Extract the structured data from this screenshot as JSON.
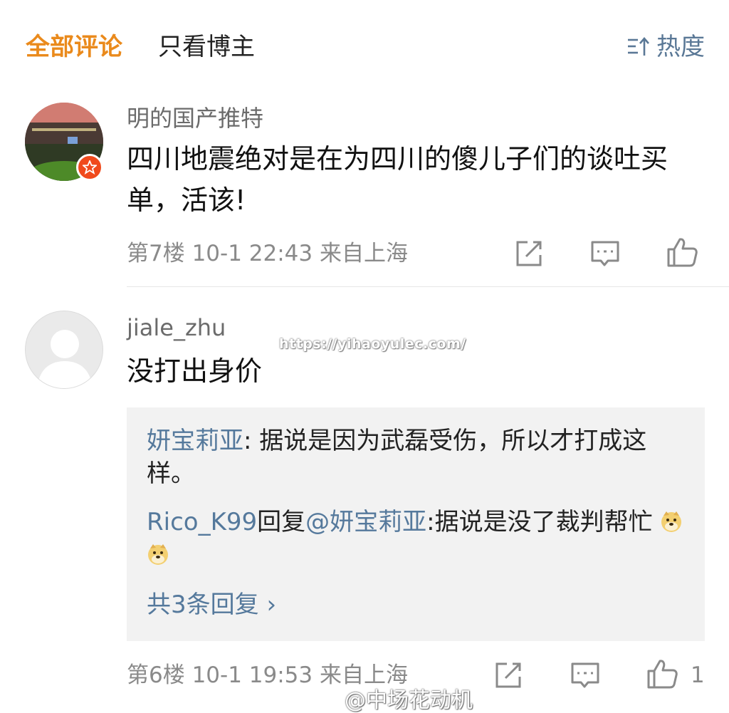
{
  "tabs": {
    "all": "全部评论",
    "blogger_only": "只看博主",
    "sort": "热度"
  },
  "comments": [
    {
      "username": "明的国产推特",
      "text": "四川地震绝对是在为四川的傻儿子们的谈吐买单，活该!",
      "meta": "第7楼 10-1 22:43 来自上海",
      "likes": ""
    },
    {
      "username": "jiale_zhu",
      "text": "没打出身价",
      "meta": "第6楼 10-1 19:53 来自上海",
      "likes": "1",
      "replies": [
        {
          "name": "妍宝莉亚",
          "sep": ": ",
          "text": "据说是因为武磊受伤，所以才打成这样。"
        },
        {
          "name": "Rico_K99",
          "mid": "回复",
          "mention": "@妍宝莉亚",
          "sep": ":",
          "text": "据说是没了裁判帮忙"
        }
      ],
      "more_replies": "共3条回复 ›"
    }
  ],
  "watermarks": {
    "url": "https://yihaoyulec.com/",
    "weibo": "@中场花动机"
  },
  "icons": {
    "sort": "sort-icon",
    "repost": "repost-icon",
    "comment": "comment-icon",
    "like": "thumbs-up-icon",
    "badge": "star-badge-icon",
    "emoji": "doge-emoji"
  },
  "colors": {
    "active_tab": "#ea8a1c",
    "link_blue": "#55799c",
    "meta_gray": "#8a8a8a",
    "reply_bg": "#f2f2f2"
  }
}
